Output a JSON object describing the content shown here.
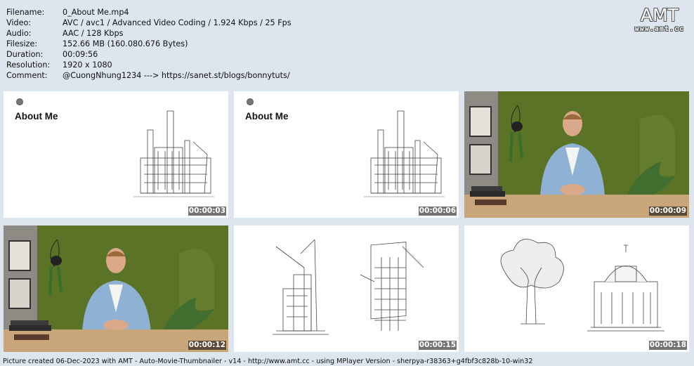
{
  "meta": {
    "rows": [
      {
        "key": "Filename:",
        "value": "0_About Me.mp4"
      },
      {
        "key": "Video:",
        "value": "AVC / avc1 / Advanced Video Coding / 1.924 Kbps / 25 Fps"
      },
      {
        "key": "Audio:",
        "value": "AAC / 128 Kbps"
      },
      {
        "key": "Filesize:",
        "value": "152.66 MB (160.080.676 Bytes)"
      },
      {
        "key": "Duration:",
        "value": "00:09:56"
      },
      {
        "key": "Resolution:",
        "value": "1920 x 1080"
      },
      {
        "key": "Comment:",
        "value": "@CuongNhung1234 ---> https://sanet.st/blogs/bonnytuts/"
      }
    ]
  },
  "logo": {
    "big": "AMT",
    "small": "www.amt.cc"
  },
  "thumbs": [
    {
      "timestamp": "00:00:03",
      "title": "About Me",
      "scene": "about-slide"
    },
    {
      "timestamp": "00:00:06",
      "title": "About Me",
      "scene": "about-slide"
    },
    {
      "timestamp": "00:00:09",
      "scene": "presenter"
    },
    {
      "timestamp": "00:00:12",
      "scene": "presenter"
    },
    {
      "timestamp": "00:00:15",
      "scene": "cranes-sketch"
    },
    {
      "timestamp": "00:00:18",
      "scene": "tree-cathedral-sketch"
    }
  ],
  "footer": "Picture created 06-Dec-2023 with AMT - Auto-Movie-Thumbnailer - v14 - http://www.amt.cc - using MPlayer Version - sherpya-r38363+g4fbf3c828b-10-win32",
  "colors": {
    "background": "#dde5ee",
    "green_wall": "#5a7326",
    "desk": "#c9a57a"
  }
}
